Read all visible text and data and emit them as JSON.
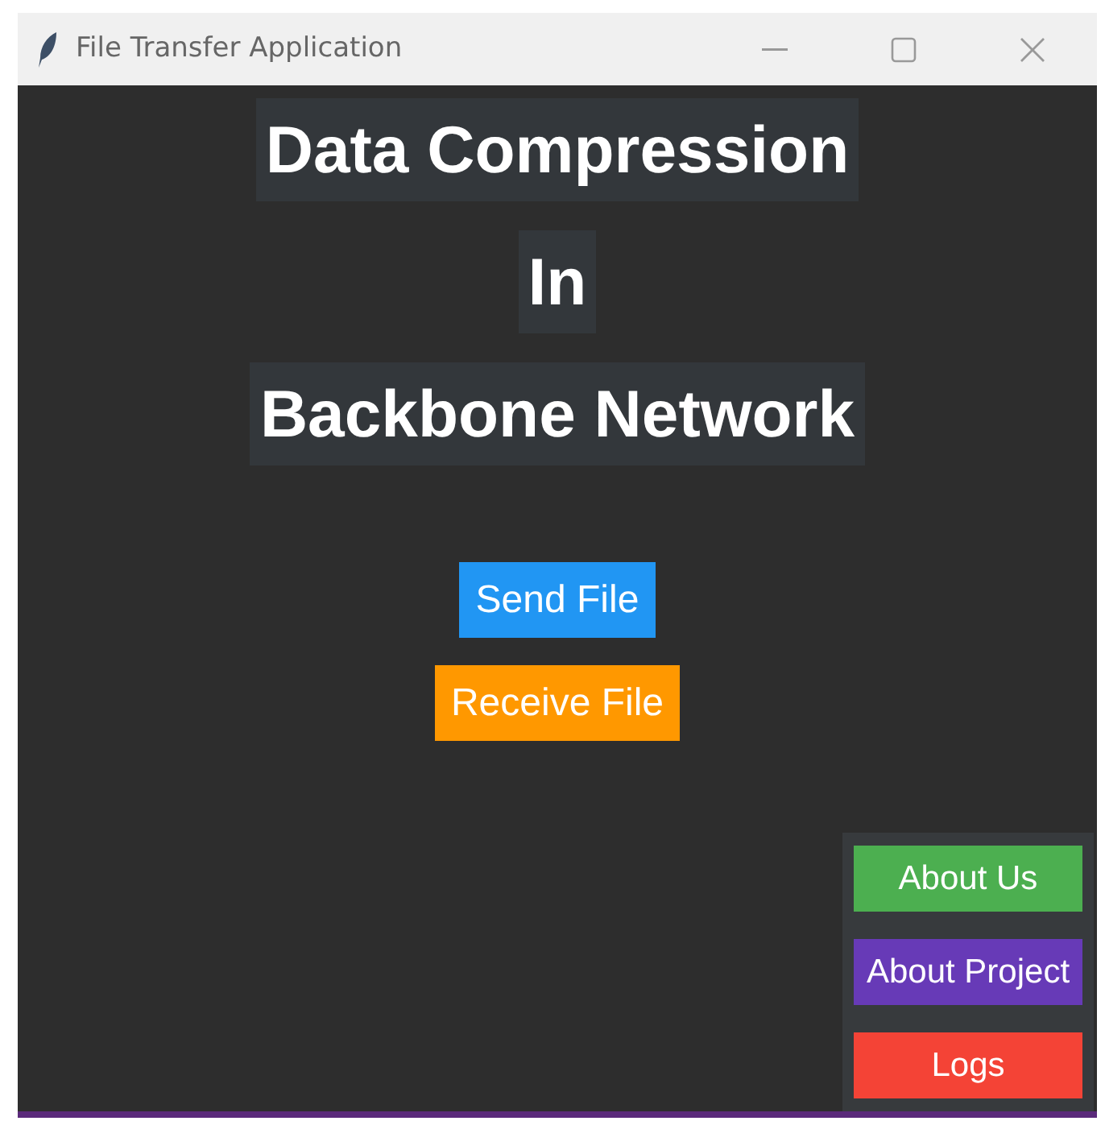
{
  "window": {
    "title": "File Transfer Application"
  },
  "headings": [
    "Data Compression",
    "In",
    "Backbone Network"
  ],
  "main_buttons": [
    {
      "label": "Send File",
      "color": "#2196f3"
    },
    {
      "label": "Receive File",
      "color": "#ff9800"
    }
  ],
  "side_buttons": [
    {
      "label": "About Us",
      "color": "#4caf50"
    },
    {
      "label": "About Project",
      "color": "#673ab7"
    },
    {
      "label": "Logs",
      "color": "#f44336"
    }
  ]
}
